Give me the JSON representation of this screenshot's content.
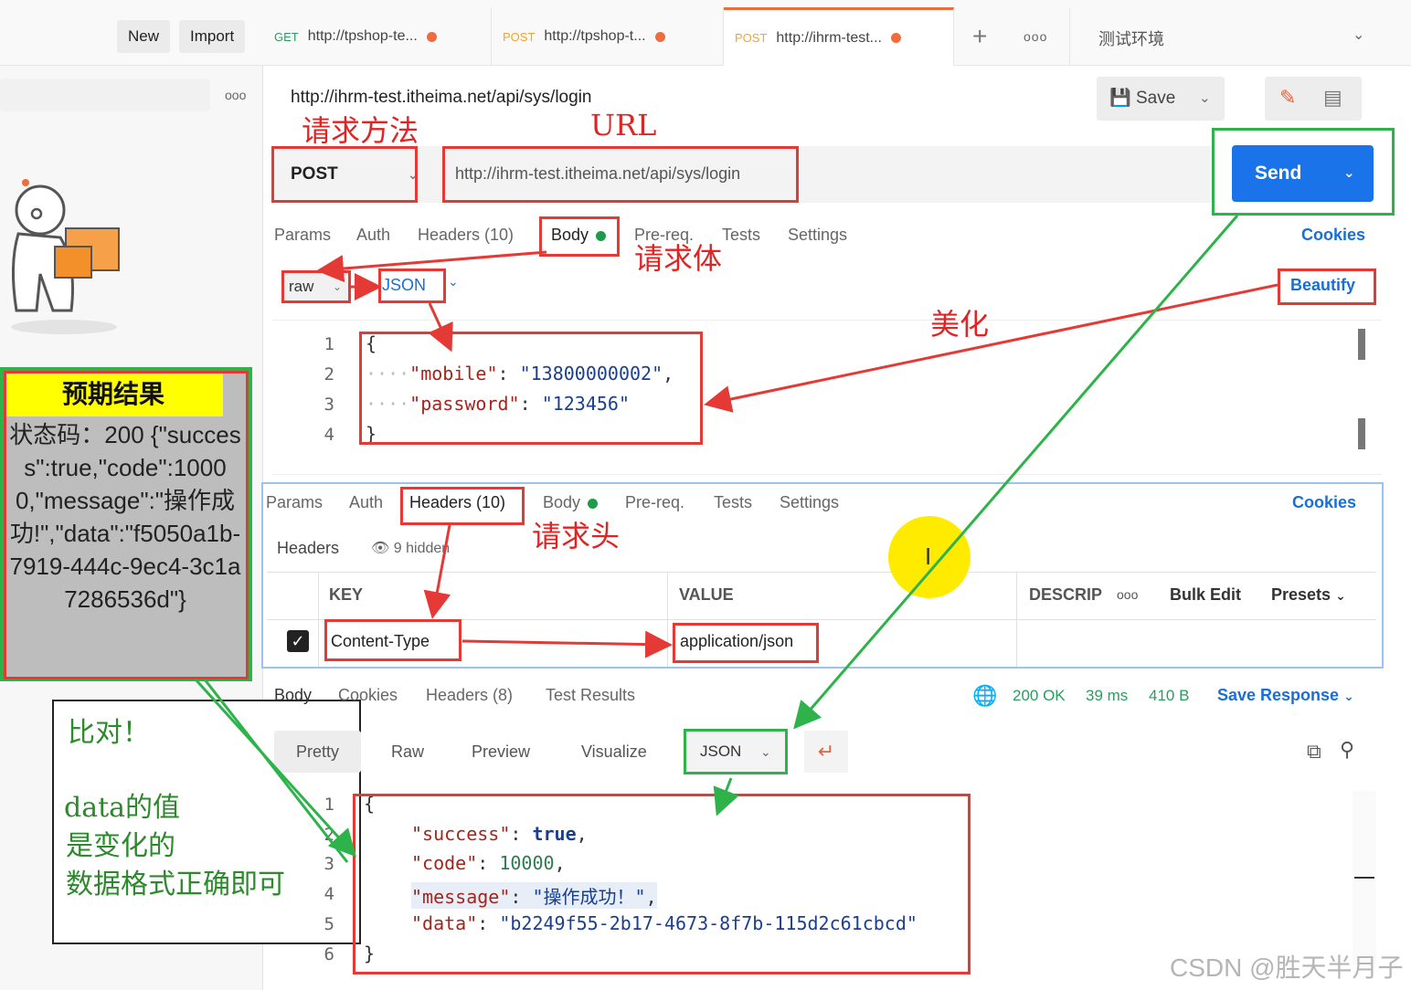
{
  "toolbar": {
    "new_label": "New",
    "import_label": "Import",
    "more": "ooo"
  },
  "tabs": [
    {
      "method": "GET",
      "label": "http://tpshop-te...",
      "method_color": "#2a9d5f"
    },
    {
      "method": "POST",
      "label": "http://tpshop-t...",
      "method_color": "#f4a22d"
    },
    {
      "method": "POST",
      "label": "http://ihrm-test...",
      "method_color": "#f4a22d"
    }
  ],
  "tab_add": "+",
  "tab_more": "ooo",
  "environment": "测试环境",
  "sidebar": {
    "more": "ooo"
  },
  "request": {
    "title": "http://ihrm-test.itheima.net/api/sys/login",
    "method": "POST",
    "url": "http://ihrm-test.itheima.net/api/sys/login",
    "save_label": "Save",
    "send_label": "Send",
    "tabs": [
      "Params",
      "Auth",
      "Headers (10)",
      "Body",
      "Pre-req.",
      "Tests",
      "Settings"
    ],
    "cookies": "Cookies",
    "body_mode": "raw",
    "body_lang": "JSON",
    "beautify": "Beautify",
    "body_lines": [
      {
        "no": "1",
        "text": "{"
      },
      {
        "no": "2",
        "key": "\"mobile\"",
        "value": "\"13800000002\""
      },
      {
        "no": "3",
        "key": "\"password\"",
        "value": "\"123456\""
      },
      {
        "no": "4",
        "text": "}"
      }
    ]
  },
  "headers_panel": {
    "tabs": [
      "Params",
      "Auth",
      "Headers (10)",
      "Body",
      "Pre-req.",
      "Tests",
      "Settings"
    ],
    "cookies": "Cookies",
    "section_label": "Headers",
    "hidden_label": "9 hidden",
    "col_key": "KEY",
    "col_value": "VALUE",
    "col_desc": "DESCRIP",
    "more": "ooo",
    "bulk_edit": "Bulk Edit",
    "presets": "Presets",
    "row": {
      "checked": true,
      "key": "Content-Type",
      "value": "application/json"
    }
  },
  "response": {
    "tabs": [
      "Body",
      "Cookies",
      "Headers (8)",
      "Test Results"
    ],
    "status": "200 OK",
    "time": "39 ms",
    "size": "410 B",
    "save_response": "Save Response",
    "views": [
      "Pretty",
      "Raw",
      "Preview",
      "Visualize"
    ],
    "format": "JSON",
    "lines": [
      {
        "no": "1",
        "text": "{"
      },
      {
        "no": "2",
        "key": "\"success\"",
        "value": "true"
      },
      {
        "no": "3",
        "key": "\"code\"",
        "value": "10000"
      },
      {
        "no": "4",
        "key": "\"message\"",
        "value": "\"操作成功！\""
      },
      {
        "no": "5",
        "key": "\"data\"",
        "value": "\"b2249f55-2b17-4673-8f7b-115d2c61cbcd\""
      },
      {
        "no": "6",
        "text": "}"
      }
    ]
  },
  "expected": {
    "title": "预期结果",
    "text": "状态码：200 {\"success\":true,\"code\":10000,\"message\":\"操作成功!\",\"data\":\"f5050a1b-7919-444c-9ec4-3c1a7286536d\"}"
  },
  "annotations": {
    "method": "请求方法",
    "url": "URL",
    "body": "请求体",
    "beautify": "美化",
    "headers": "请求头",
    "note_line1": "比对！",
    "note_line2": "data的值",
    "note_line3": "是变化的",
    "note_line4": "数据格式正确即可"
  },
  "watermark": "CSDN @胜天半月子"
}
